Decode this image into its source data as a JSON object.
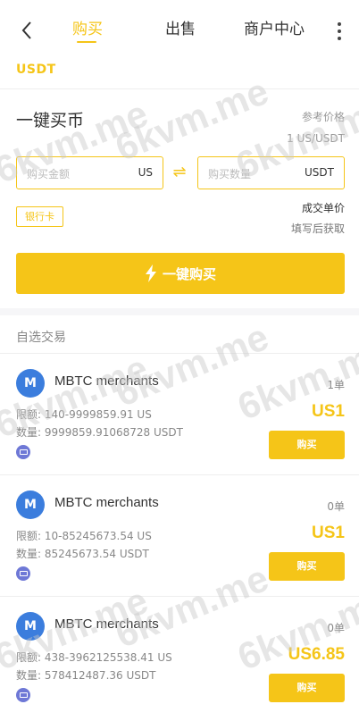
{
  "header": {
    "tabs": [
      {
        "label": "购买",
        "active": true
      },
      {
        "label": "出售",
        "active": false
      },
      {
        "label": "商户中心",
        "active": false
      }
    ]
  },
  "coin": "USDT",
  "quick_buy": {
    "title": "一键买币",
    "reference_label": "参考价格",
    "reference_value": "1 US/USDT",
    "amount_placeholder": "购买金额",
    "amount_unit": "US",
    "qty_placeholder": "购买数量",
    "qty_unit": "USDT",
    "payment_tag": "银行卡",
    "deal_price_label": "成交单价",
    "deal_price_value": "填写后获取",
    "buy_button": "一键购买"
  },
  "section_title": "自选交易",
  "merchants": [
    {
      "avatar": "M",
      "name": "MBTC merchants",
      "orders": "1单",
      "limit": "限额: 140-9999859.91 US",
      "quantity": "数量: 9999859.91068728 USDT",
      "price": "US1",
      "buy_label": "购买"
    },
    {
      "avatar": "M",
      "name": "MBTC merchants",
      "orders": "0单",
      "limit": "限额: 10-85245673.54 US",
      "quantity": "数量: 85245673.54 USDT",
      "price": "US1",
      "buy_label": "购买"
    },
    {
      "avatar": "M",
      "name": "MBTC merchants",
      "orders": "0单",
      "limit": "限额: 438-3962125538.41 US",
      "quantity": "数量: 578412487.36 USDT",
      "price": "US6.85",
      "buy_label": "购买"
    }
  ],
  "watermark": "6kvm.me",
  "colors": {
    "accent": "#f5c518",
    "avatar": "#3b7ddd",
    "pay_icon": "#6e78d6"
  }
}
